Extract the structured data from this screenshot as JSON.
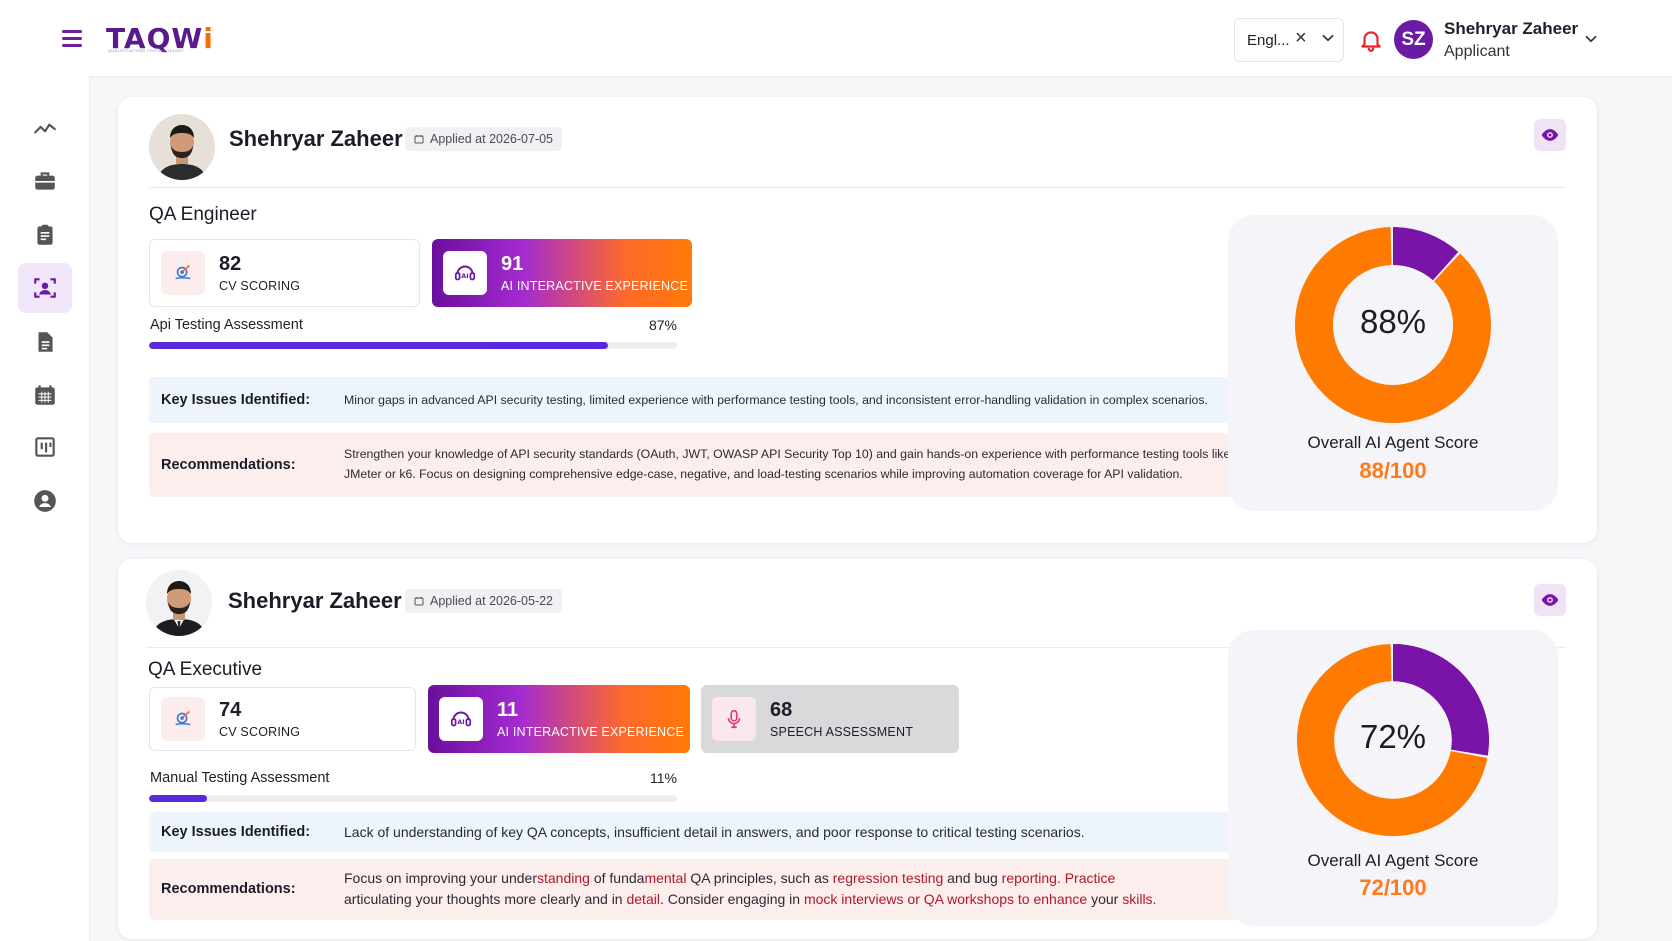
{
  "header": {
    "logo_main": "TAQW",
    "logo_accent": "i",
    "logo_tagline": "QUALIFICATIONS TESTING TALENT",
    "language": "Engl...",
    "user_initials": "SZ",
    "user_name": "Shehryar Zaheer",
    "user_role": "Applicant"
  },
  "sidebar": {
    "items": [
      {
        "icon": "chart-line-icon"
      },
      {
        "icon": "briefcase-icon"
      },
      {
        "icon": "clipboard-icon"
      },
      {
        "icon": "candidate-scan-icon",
        "active": true
      },
      {
        "icon": "document-icon"
      },
      {
        "icon": "calendar-icon"
      },
      {
        "icon": "board-icon"
      },
      {
        "icon": "user-circle-icon"
      }
    ]
  },
  "applications": [
    {
      "name": "Shehryar Zaheer",
      "applied": "Applied at 2026-07-05",
      "job_title": "QA Engineer",
      "scores": [
        {
          "value": "82",
          "label": "CV SCORING",
          "style": "plain",
          "icon": "cv-target-icon"
        },
        {
          "value": "91",
          "label": "AI INTERACTIVE EXPERIENCE",
          "style": "gradient",
          "icon": "ai-headset-icon"
        }
      ],
      "assessment": {
        "label": "Api Testing Assessment",
        "percent_text": "87%",
        "percent": 87
      },
      "key_issues_label": "Key Issues Identified:",
      "key_issues": "Minor gaps in advanced API security testing, limited experience with performance testing tools, and inconsistent error-handling validation in complex scenarios.",
      "recommendations_label": "Recommendations:",
      "recommendations_line1": "Strengthen your knowledge of API security standards (OAuth, JWT, OWASP API Security Top 10) and gain hands-on experience with performance testing tools like",
      "recommendations_line2": "JMeter or k6. Focus on designing comprehensive edge-case, negative, and load-testing scenarios while improving automation coverage for API validation.",
      "overall": {
        "percent_text": "88%",
        "percent": 88,
        "label": "Overall AI Agent Score",
        "score_text": "88/100"
      }
    },
    {
      "name": "Shehryar Zaheer",
      "applied": "Applied at 2026-05-22",
      "job_title": "QA Executive",
      "scores": [
        {
          "value": "74",
          "label": "CV SCORING",
          "style": "plain",
          "icon": "cv-target-icon"
        },
        {
          "value": "11",
          "label": "AI INTERACTIVE EXPERIENCE",
          "style": "gradient",
          "icon": "ai-headset-icon"
        },
        {
          "value": "68",
          "label": "SPEECH ASSESSMENT",
          "style": "grey",
          "icon": "microphone-icon"
        }
      ],
      "assessment": {
        "label": "Manual Testing Assessment",
        "percent_text": "11%",
        "percent": 11
      },
      "key_issues_label": "Key Issues Identified:",
      "key_issues": "Lack of understanding of key QA concepts, insufficient detail in answers, and poor response to critical testing scenarios.",
      "recommendations_label": "Recommendations:",
      "rec2_seg": [
        "Focus on improving your under",
        "standing",
        " of funda",
        "mental",
        " QA principles, such as ",
        "regression testing",
        " and bug ",
        "reporting. Practice"
      ],
      "rec2_seg_b": [
        "articulating your thoughts more clearly and in ",
        "detail",
        ". Consider engaging in ",
        "mock interviews or QA workshops",
        " to enhance",
        " your ",
        "skills."
      ],
      "overall": {
        "percent_text": "72%",
        "percent": 72,
        "label": "Overall AI Agent Score",
        "score_text": "72/100"
      }
    }
  ],
  "colors": {
    "brand_purple": "#6b1aa6",
    "accent_orange": "#ff7a1a",
    "donut_orange": "#ff7a00",
    "donut_purple": "#7a13a8",
    "bar_fill": "#5b2bd8"
  }
}
